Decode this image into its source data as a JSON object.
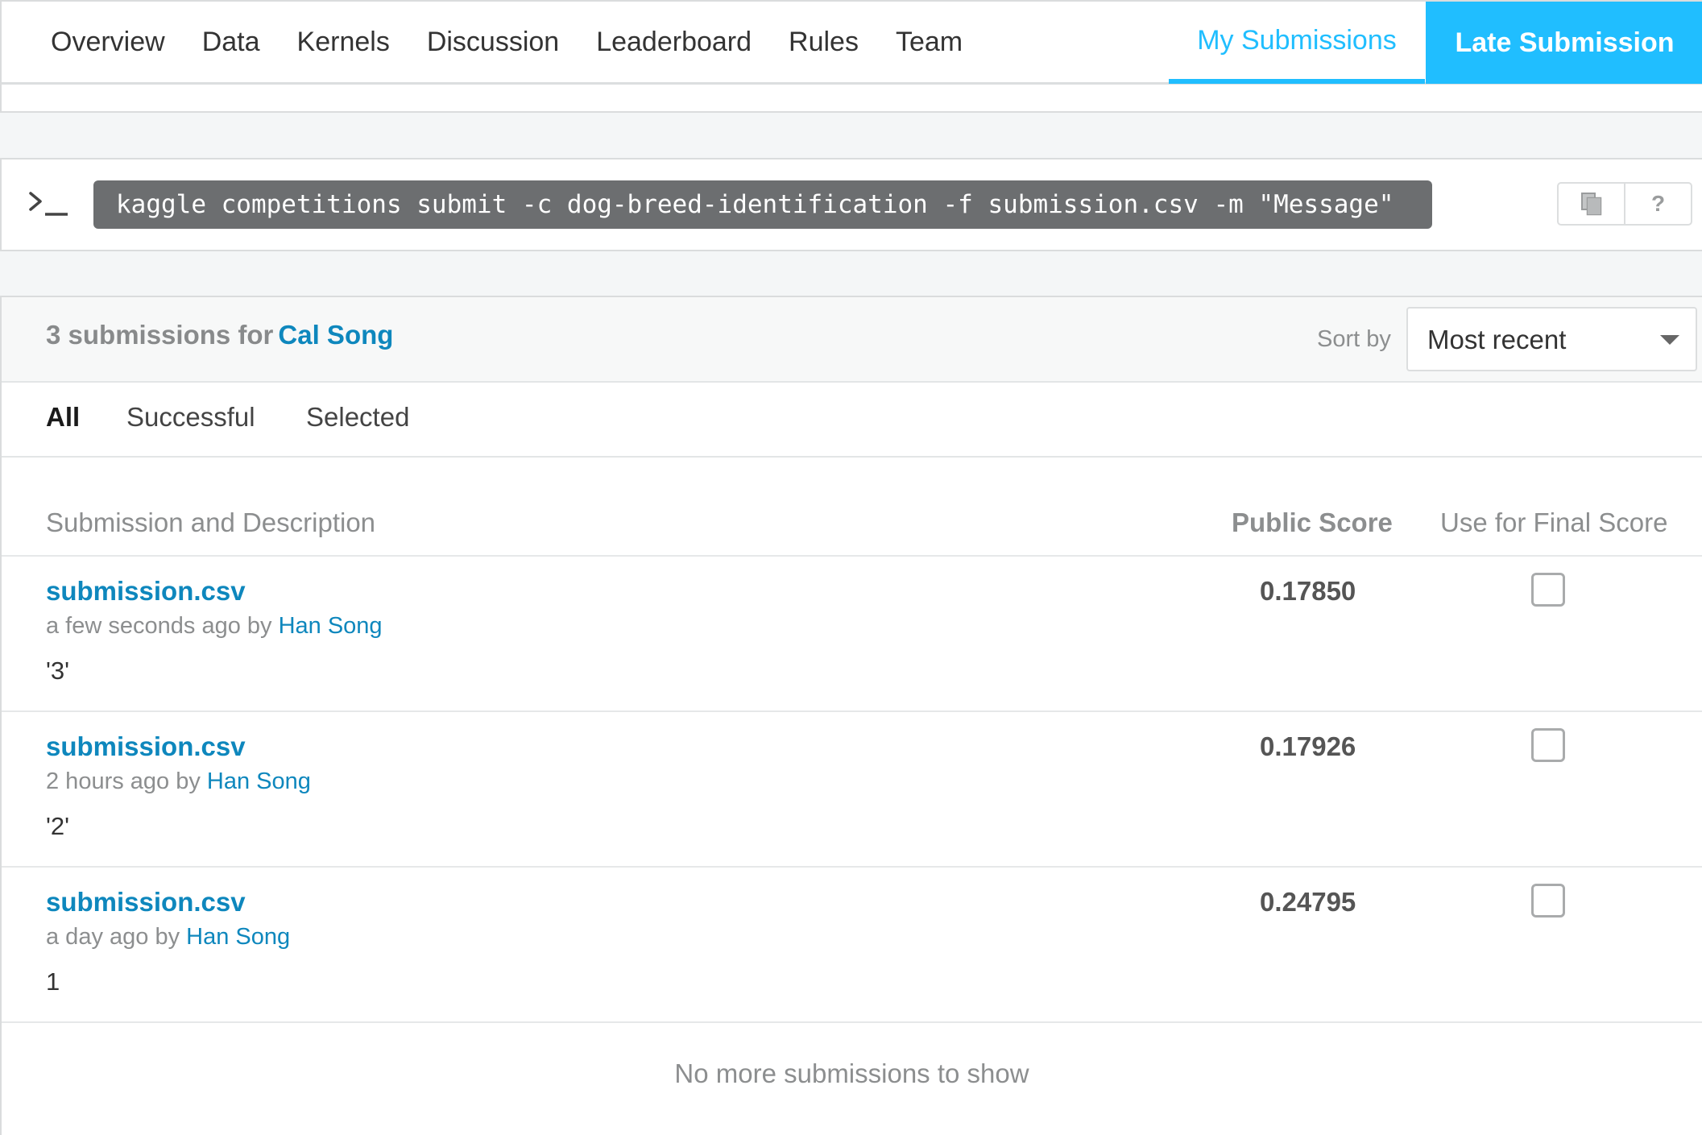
{
  "nav": {
    "tabs": [
      "Overview",
      "Data",
      "Kernels",
      "Discussion",
      "Leaderboard",
      "Rules",
      "Team"
    ],
    "my_submissions": "My Submissions",
    "late_submission": "Late Submission"
  },
  "api": {
    "command": "kaggle competitions submit -c dog-breed-identification -f submission.csv -m \"Message\"",
    "prompt_icon": "terminal-prompt-icon",
    "copy_icon": "copy-icon",
    "help_label": "?"
  },
  "submissions": {
    "count_text": "3 submissions for",
    "user": "Cal Song",
    "sort_label": "Sort by",
    "sort_value": "Most recent",
    "filters": [
      {
        "label": "All",
        "active": true
      },
      {
        "label": "Successful",
        "active": false
      },
      {
        "label": "Selected",
        "active": false
      }
    ],
    "columns": {
      "description": "Submission and Description",
      "public_score": "Public Score",
      "final_score": "Use for Final Score"
    },
    "rows": [
      {
        "file": "submission.csv",
        "time": "a few seconds ago by",
        "author": "Han Song",
        "description": "'3'",
        "score": "0.17850",
        "selected": false
      },
      {
        "file": "submission.csv",
        "time": "2 hours ago by",
        "author": "Han Song",
        "description": "'2'",
        "score": "0.17926",
        "selected": false
      },
      {
        "file": "submission.csv",
        "time": "a day ago by",
        "author": "Han Song",
        "description": "1",
        "score": "0.24795",
        "selected": false
      }
    ],
    "footer": "No more submissions to show"
  },
  "colors": {
    "accent": "#20beff",
    "link": "#0e87bd",
    "command_bg": "#6c6e70",
    "muted_text": "#8c8e8f"
  }
}
